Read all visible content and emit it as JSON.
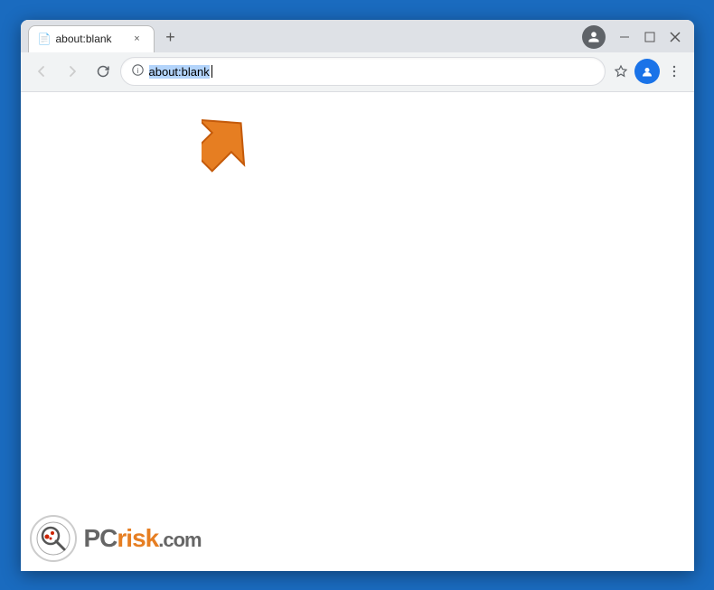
{
  "browser": {
    "tab": {
      "favicon": "📄",
      "title": "about:blank",
      "close_label": "×"
    },
    "new_tab_label": "+",
    "window_controls": {
      "minimize": "—",
      "maximize": "□",
      "close": "✕"
    },
    "profile_icon": "👤",
    "nav": {
      "back_label": "←",
      "forward_label": "→",
      "refresh_label": "↻",
      "address": "about:blank",
      "star_label": "☆",
      "account_label": "🔵",
      "menu_label": "⋮"
    }
  },
  "page": {
    "content": "",
    "arrow_title": "pointing arrow annotation"
  },
  "watermark": {
    "brand": "PC",
    "risk": "risk",
    "dot_com": ".com"
  }
}
